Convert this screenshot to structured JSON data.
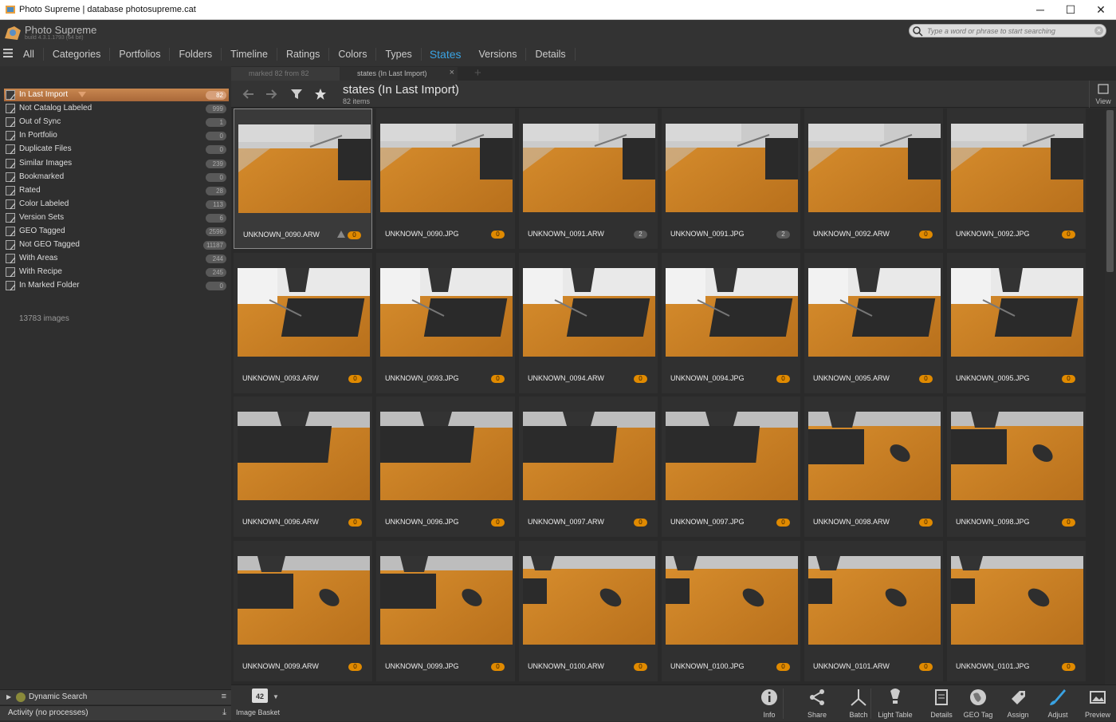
{
  "window": {
    "title": "Photo Supreme | database photosupreme.cat",
    "controls": {
      "minimize": "─",
      "maximize": "☐",
      "close": "✕"
    }
  },
  "app": {
    "name": "Photo Supreme",
    "build": "build 4.3.1.1793 (64 bit)"
  },
  "search": {
    "placeholder": "Type a word or phrase to start searching"
  },
  "nav": {
    "tabs": [
      "All",
      "Categories",
      "Portfolios",
      "Folders",
      "Timeline",
      "Ratings",
      "Colors",
      "Types",
      "States",
      "Versions",
      "Details"
    ],
    "active": "States"
  },
  "sidebar": {
    "items": [
      {
        "label": "In Last Import",
        "count": "82"
      },
      {
        "label": "Not Catalog Labeled",
        "count": "999"
      },
      {
        "label": "Out of Sync",
        "count": "1"
      },
      {
        "label": "In Portfolio",
        "count": "0"
      },
      {
        "label": "Duplicate Files",
        "count": "0"
      },
      {
        "label": "Similar Images",
        "count": "239"
      },
      {
        "label": "Bookmarked",
        "count": "0"
      },
      {
        "label": "Rated",
        "count": "28"
      },
      {
        "label": "Color Labeled",
        "count": "113"
      },
      {
        "label": "Version Sets",
        "count": "6"
      },
      {
        "label": "GEO Tagged",
        "count": "2596"
      },
      {
        "label": "Not GEO Tagged",
        "count": "11187"
      },
      {
        "label": "With Areas",
        "count": "244"
      },
      {
        "label": "With Recipe",
        "count": "245"
      },
      {
        "label": "In Marked Folder",
        "count": "0"
      }
    ],
    "total": "13783 images",
    "dynamic_search": "Dynamic Search",
    "activity": "Activity (no processes)"
  },
  "doc_tabs": [
    {
      "label": "marked 82 from 82"
    },
    {
      "label": "states (In Last Import)"
    }
  ],
  "page": {
    "title": "states (In Last Import)",
    "count": "82 items",
    "view_label": "View"
  },
  "images": [
    {
      "name": "UNKNOWN_0090.ARW",
      "count": "0",
      "warn": true,
      "scene": "monitor"
    },
    {
      "name": "UNKNOWN_0090.JPG",
      "count": "0",
      "scene": "monitor"
    },
    {
      "name": "UNKNOWN_0091.ARW",
      "count": "2",
      "scene": "monitor"
    },
    {
      "name": "UNKNOWN_0091.JPG",
      "count": "2",
      "scene": "monitor"
    },
    {
      "name": "UNKNOWN_0092.ARW",
      "count": "0",
      "scene": "monitor"
    },
    {
      "name": "UNKNOWN_0092.JPG",
      "count": "0",
      "scene": "monitor"
    },
    {
      "name": "UNKNOWN_0093.ARW",
      "count": "0",
      "scene": "keyboard"
    },
    {
      "name": "UNKNOWN_0093.JPG",
      "count": "0",
      "scene": "keyboard"
    },
    {
      "name": "UNKNOWN_0094.ARW",
      "count": "0",
      "scene": "keyboard"
    },
    {
      "name": "UNKNOWN_0094.JPG",
      "count": "0",
      "scene": "keyboard"
    },
    {
      "name": "UNKNOWN_0095.ARW",
      "count": "0",
      "scene": "keyboard"
    },
    {
      "name": "UNKNOWN_0095.JPG",
      "count": "0",
      "scene": "keyboard"
    },
    {
      "name": "UNKNOWN_0096.ARW",
      "count": "0",
      "scene": "keyboard2"
    },
    {
      "name": "UNKNOWN_0096.JPG",
      "count": "0",
      "scene": "keyboard2"
    },
    {
      "name": "UNKNOWN_0097.ARW",
      "count": "0",
      "scene": "keyboard2"
    },
    {
      "name": "UNKNOWN_0097.JPG",
      "count": "0",
      "scene": "keyboard2"
    },
    {
      "name": "UNKNOWN_0098.ARW",
      "count": "0",
      "scene": "mousekb"
    },
    {
      "name": "UNKNOWN_0098.JPG",
      "count": "0",
      "scene": "mousekb"
    },
    {
      "name": "UNKNOWN_0099.ARW",
      "count": "0",
      "scene": "mousekb"
    },
    {
      "name": "UNKNOWN_0099.JPG",
      "count": "0",
      "scene": "mousekb"
    },
    {
      "name": "UNKNOWN_0100.ARW",
      "count": "0",
      "scene": "mouse"
    },
    {
      "name": "UNKNOWN_0100.JPG",
      "count": "0",
      "scene": "mouse"
    },
    {
      "name": "UNKNOWN_0101.ARW",
      "count": "0",
      "scene": "mouse"
    },
    {
      "name": "UNKNOWN_0101.JPG",
      "count": "0",
      "scene": "mouse"
    }
  ],
  "basket": {
    "label": "Image Basket",
    "count": "42"
  },
  "bottom_tools": [
    {
      "label": "Info",
      "icon": "info-icon"
    },
    {
      "label": "Share",
      "icon": "share-icon"
    },
    {
      "label": "Batch",
      "icon": "batch-icon"
    },
    {
      "label": "Light Table",
      "icon": "light-table-icon"
    },
    {
      "label": "Details",
      "icon": "details-icon"
    },
    {
      "label": "GEO Tag",
      "icon": "geo-tag-icon"
    },
    {
      "label": "Assign",
      "icon": "assign-icon"
    },
    {
      "label": "Adjust",
      "icon": "adjust-icon"
    },
    {
      "label": "Preview",
      "icon": "preview-icon"
    }
  ],
  "colors": {
    "accent": "#3aa3e3",
    "selected": "#b9794a",
    "badge": "#e08a00"
  }
}
